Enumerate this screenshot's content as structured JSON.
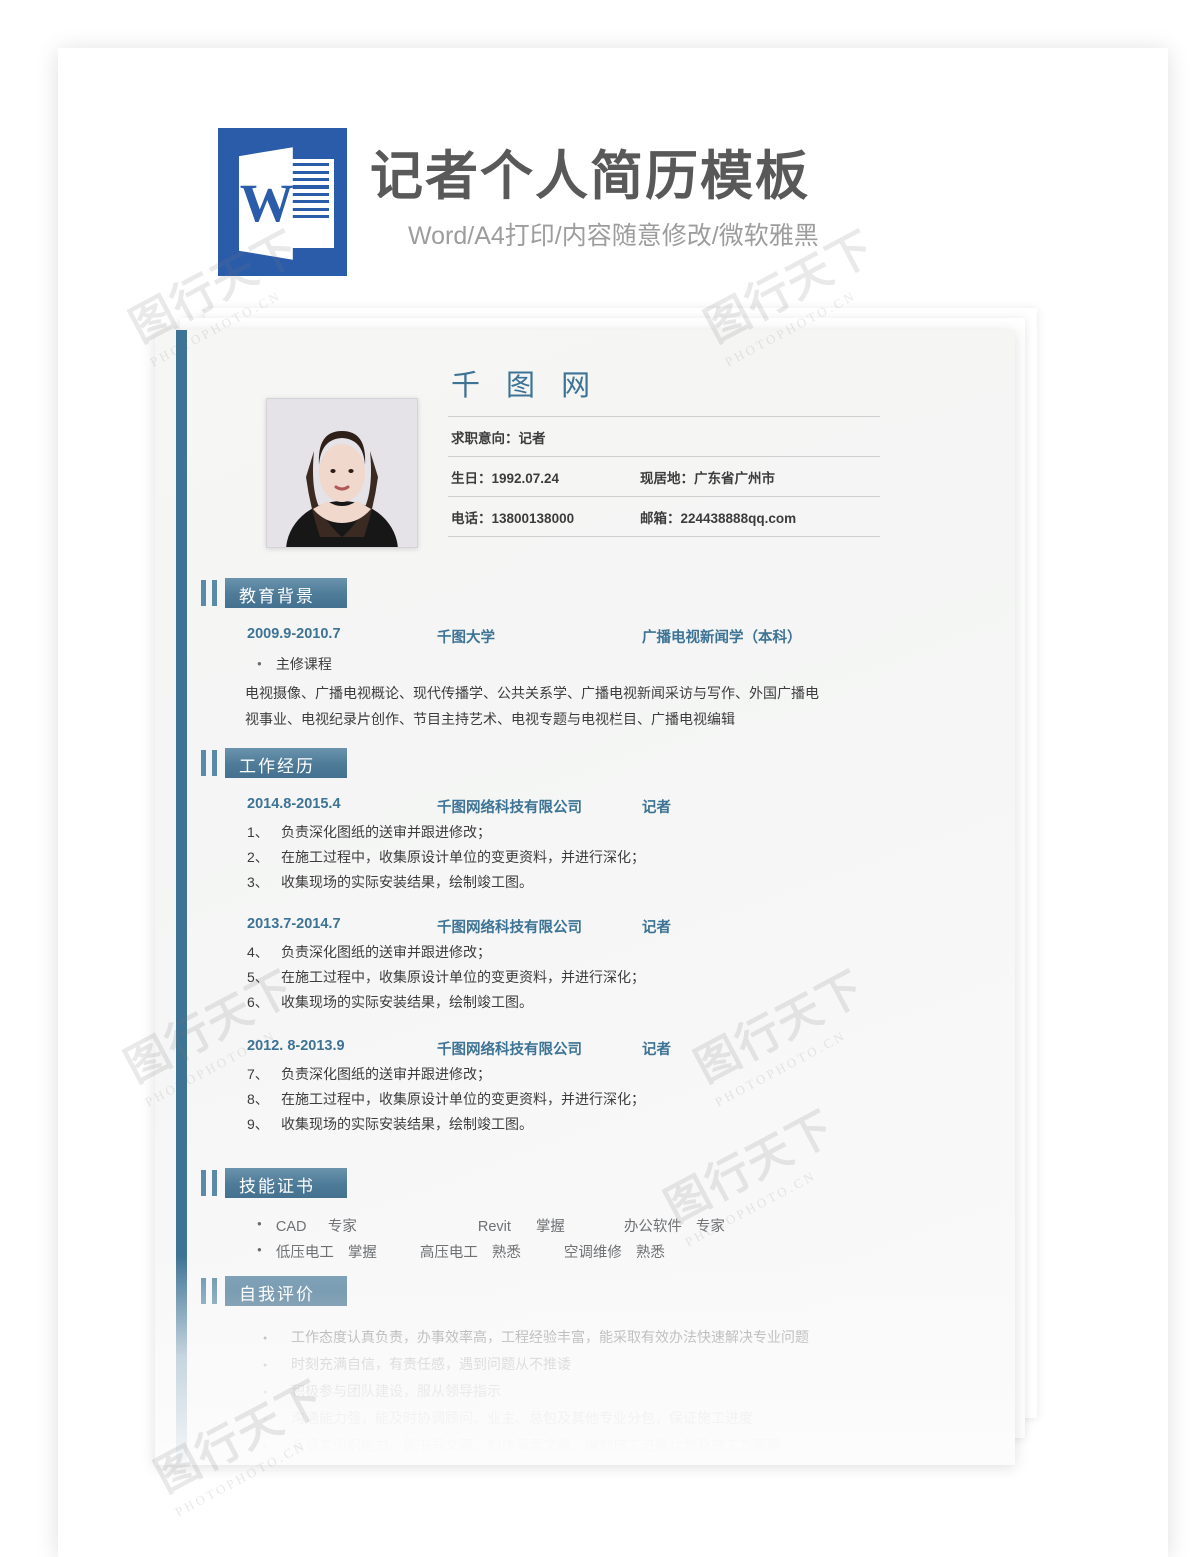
{
  "header": {
    "icon": "word-icon",
    "icon_letter": "W",
    "title": "记者个人简历模板",
    "subtitle": "Word/A4打印/内容随意修改/微软雅黑"
  },
  "theme": {
    "accent_blue": "#3d7395",
    "badge_blue": "#4d7b98",
    "word_icon_blue": "#2a5caa",
    "title_gray": "#595959",
    "subtitle_gray": "#9d9d9d"
  },
  "resume": {
    "candidate_name": "千 图 网",
    "objective_label": "求职意向：记者",
    "info_rows": [
      {
        "left": "生日：1992.07.24",
        "right": "现居地：广东省广州市"
      },
      {
        "left": "电话：13800138000",
        "right": "邮箱：224438888qq.com"
      }
    ],
    "sections": {
      "education": {
        "title": "教育背景",
        "entry": {
          "date": "2009.9-2010.7",
          "school": "千图大学",
          "major": "广播电视新闻学（本科）"
        },
        "courses_label": "主修课程",
        "courses_line_1": "电视摄像、广播电视概论、现代传播学、公共关系学、广播电视新闻采访与写作、外国广播电",
        "courses_line_2": "视事业、电视纪录片创作、节目主持艺术、电视专题与电视栏目、广播电视编辑"
      },
      "experience": {
        "title": "工作经历",
        "jobs": [
          {
            "date": "2014.8-2015.4",
            "company": "千图网络科技有限公司",
            "role": "记者",
            "duties": [
              {
                "num": "1、",
                "text": "负责深化图纸的送审并跟进修改；"
              },
              {
                "num": "2、",
                "text": "在施工过程中，收集原设计单位的变更资料，并进行深化；"
              },
              {
                "num": "3、",
                "text": "收集现场的实际安装结果，绘制竣工图。"
              }
            ]
          },
          {
            "date": "2013.7-2014.7",
            "company": "千图网络科技有限公司",
            "role": "记者",
            "duties": [
              {
                "num": "4、",
                "text": "负责深化图纸的送审并跟进修改；"
              },
              {
                "num": "5、",
                "text": "在施工过程中，收集原设计单位的变更资料，并进行深化；"
              },
              {
                "num": "6、",
                "text": "收集现场的实际安装结果，绘制竣工图。"
              }
            ]
          },
          {
            "date": "2012. 8-2013.9",
            "company": "千图网络科技有限公司",
            "role": "记者",
            "duties": [
              {
                "num": "7、",
                "text": "负责深化图纸的送审并跟进修改；"
              },
              {
                "num": "8、",
                "text": "在施工过程中，收集原设计单位的变更资料，并进行深化；"
              },
              {
                "num": "9、",
                "text": "收集现场的实际安装结果，绘制竣工图。"
              }
            ]
          }
        ]
      },
      "skills": {
        "title": "技能证书",
        "rows": [
          [
            {
              "name": "CAD",
              "level": "专家"
            },
            {
              "name": "Revit",
              "level": "掌握"
            },
            {
              "name": "办公软件",
              "level": "专家"
            }
          ],
          [
            {
              "name": "低压电工",
              "level": "掌握"
            },
            {
              "name": "高压电工",
              "level": "熟悉"
            },
            {
              "name": "空调维修",
              "level": "熟悉"
            }
          ]
        ]
      },
      "self_evaluation": {
        "title": "自我评价",
        "items": [
          "工作态度认真负责，办事效率高，工程经验丰富，能采取有效办法快速解决专业问题",
          "时刻充满自信，有责任感，遇到问题从不推诿",
          "积极参与团队建设，服从领导指示",
          "沟通能力强，能及时协调顾问、业主、总包及其他专业分包，保证施工进度",
          "有语言组织能力，能书写文案、制作演示文稿、编制施工进度计划及施工方案等"
        ]
      }
    }
  },
  "watermarks": [
    {
      "big": "图行天下",
      "small": "PHOTOPHOTO.CN"
    },
    {
      "big": "图行天下",
      "small": "PHOTOPHOTO.CN"
    },
    {
      "big": "图行天下",
      "small": "PHOTOPHOTO.CN"
    },
    {
      "big": "图行天下",
      "small": "PHOTOPHOTO.CN"
    },
    {
      "big": "图行天下",
      "small": "PHOTOPHOTO.CN"
    },
    {
      "big": "图行天下",
      "small": "PHOTOPHOTO.CN"
    }
  ]
}
